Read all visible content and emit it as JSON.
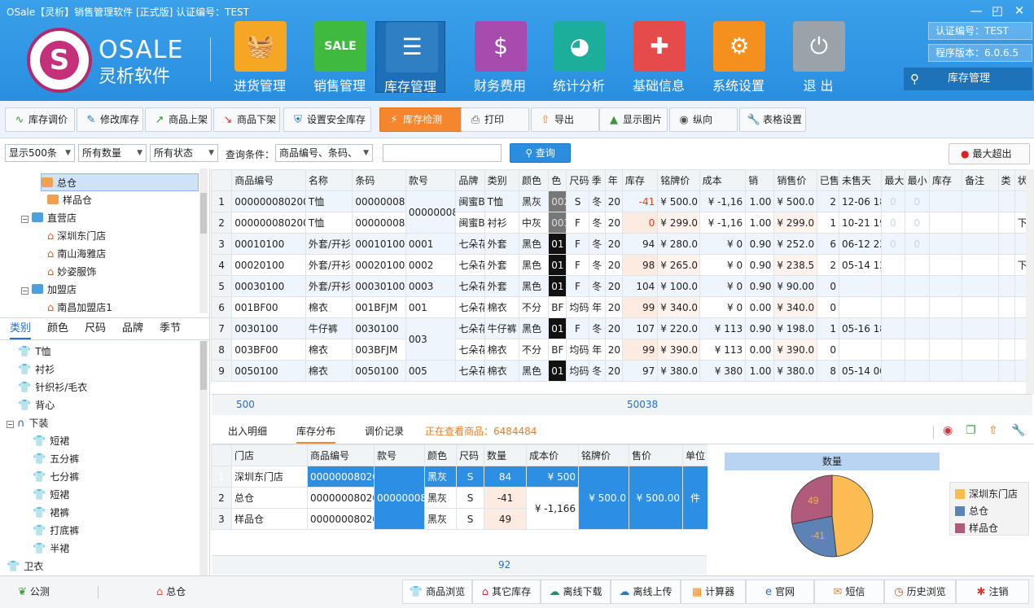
{
  "window": {
    "title": "OSale【灵析】销售管理软件   [正式版]  认证编号：TEST"
  },
  "brand": {
    "name": "OSALE",
    "subtitle": "灵析软件"
  },
  "modules": [
    {
      "label": "进货管理",
      "color": "#f5a623",
      "icon": "basket-icon",
      "glyph": "🧺"
    },
    {
      "label": "销售管理",
      "color": "#3fba3f",
      "icon": "sale-sign-icon",
      "glyph": "SALE"
    },
    {
      "label": "库存管理",
      "color": "#2f7fc4",
      "icon": "inventory-box-icon",
      "glyph": "☰"
    },
    {
      "label": "财务费用",
      "color": "#a74cae",
      "icon": "money-bag-icon",
      "glyph": "$"
    },
    {
      "label": "统计分析",
      "color": "#1cae9a",
      "icon": "pie-chart-icon",
      "glyph": "◕"
    },
    {
      "label": "基础信息",
      "color": "#e54b4b",
      "icon": "puzzle-icon",
      "glyph": "✚"
    },
    {
      "label": "系统设置",
      "color": "#f5901e",
      "icon": "gear-icon",
      "glyph": "⚙"
    },
    {
      "label": "退 出",
      "color": "#9aa3aa",
      "icon": "power-icon",
      "glyph": "⏻"
    }
  ],
  "info": {
    "cert": "认证编号：TEST",
    "version": "程序版本：6.0.6.5",
    "nav_search": "库存管理"
  },
  "toolbar": [
    {
      "label": "库存调价",
      "icon": "adjust-price-icon",
      "glyph": "∿"
    },
    {
      "label": "修改库存",
      "icon": "edit-icon",
      "glyph": "✎"
    },
    {
      "label": "商品上架",
      "icon": "trend-up-icon",
      "glyph": "↗"
    },
    {
      "label": "商品下架",
      "icon": "trend-down-icon",
      "glyph": "↘"
    },
    {
      "label": "设置安全库存",
      "icon": "shield-icon",
      "glyph": "⛨"
    },
    {
      "label": "库存检测",
      "icon": "lightning-icon",
      "glyph": "⚡"
    },
    {
      "label": "打印",
      "icon": "printer-icon",
      "glyph": "⎙"
    },
    {
      "label": "导出",
      "icon": "export-icon",
      "glyph": "⇧"
    },
    {
      "label": "显示图片",
      "icon": "image-icon",
      "glyph": "▲"
    },
    {
      "label": "纵向",
      "icon": "orientation-icon",
      "glyph": "◉"
    },
    {
      "label": "表格设置",
      "icon": "wrench-icon",
      "glyph": "🔧"
    }
  ],
  "filters": {
    "show": "显示500条",
    "qty": "所有数量",
    "status": "所有状态",
    "cond_label": "查询条件：",
    "cond": "商品编号、条码、",
    "search_value": "",
    "query": "查询",
    "max": "最大超出"
  },
  "tree": {
    "items": [
      "总仓",
      "样品仓",
      "直营店",
      "深圳东门店",
      "南山海雅店",
      "妙姿服饰",
      "加盟店",
      "南昌加盟店1"
    ]
  },
  "cat_tabs": [
    "类别",
    "颜色",
    "尺码",
    "品牌",
    "季节"
  ],
  "categories": [
    "T恤",
    "衬衫",
    "针织衫/毛衣",
    "背心",
    "下装",
    "短裙",
    "五分裤",
    "七分裤",
    "短裙",
    "裙裤",
    "打底裤",
    "半裙",
    "卫衣"
  ],
  "grid": {
    "headers": [
      "商品编号",
      "名称",
      "条码",
      "款号",
      "品牌",
      "类别",
      "颜色",
      "色",
      "尺码",
      "季",
      "年",
      "库存",
      "铭牌价",
      "成本",
      "销",
      "销售价",
      "已售",
      "未售天",
      "最大",
      "最小",
      "库存",
      "备注",
      "类",
      "状"
    ],
    "rows": [
      {
        "n": "1",
        "code": "000000080200",
        "name": "T恤",
        "bar": "000000080",
        "style": "00000008",
        "brand": "闽蜜B",
        "cat": "T恤",
        "color": "黑灰",
        "cc": "002",
        "size": "S",
        "season": "冬",
        "year": "20",
        "stock": "-41",
        "tag": "¥ 500.0",
        "cost": "¥ -1,16",
        "disc": "1.00",
        "price": "¥ 500.0",
        "sold": "2",
        "days": "12-06 18",
        "mx": "0",
        "mn": "0",
        "st": ""
      },
      {
        "n": "2",
        "code": "000000080200",
        "name": "T恤",
        "bar": "000000080",
        "style": "",
        "brand": "闽蜜B",
        "cat": "衬衫",
        "color": "中灰",
        "cc": "003",
        "size": "F",
        "season": "冬",
        "year": "20",
        "stock": "0",
        "tag": "¥ 299.0",
        "cost": "¥ -1,16",
        "disc": "1.00",
        "price": "¥ 299.0",
        "sold": "1",
        "days": "10-21 19",
        "mx": "0",
        "mn": "0",
        "st": "下"
      },
      {
        "n": "3",
        "code": "00010100",
        "name": "外套/开衫",
        "bar": "00010100",
        "style": "0001",
        "brand": "七朵花",
        "cat": "外套",
        "color": "黑色",
        "cc": "01",
        "size": "F",
        "season": "冬",
        "year": "20",
        "stock": "94",
        "tag": "¥ 280.0",
        "cost": "¥ 0",
        "disc": "0.90",
        "price": "¥ 252.0",
        "sold": "6",
        "days": "06-12 22",
        "mx": "0",
        "mn": "0",
        "st": ""
      },
      {
        "n": "4",
        "code": "00020100",
        "name": "外套/开衫",
        "bar": "00020100",
        "style": "0002",
        "brand": "七朵花",
        "cat": "外套",
        "color": "黑色",
        "cc": "01",
        "size": "F",
        "season": "冬",
        "year": "20",
        "stock": "98",
        "tag": "¥ 265.0",
        "cost": "¥ 0",
        "disc": "0.90",
        "price": "¥ 238.5",
        "sold": "2",
        "days": "05-14 12",
        "mx": "",
        "mn": "",
        "st": "下"
      },
      {
        "n": "5",
        "code": "00030100",
        "name": "外套/开衫",
        "bar": "00030100",
        "style": "0003",
        "brand": "七朵花",
        "cat": "外套",
        "color": "黑色",
        "cc": "01",
        "size": "F",
        "season": "冬",
        "year": "20",
        "stock": "104",
        "tag": "¥ 100.0",
        "cost": "¥ 0",
        "disc": "0.90",
        "price": "¥ 90.00",
        "sold": "0",
        "days": "",
        "mx": "",
        "mn": "",
        "st": ""
      },
      {
        "n": "6",
        "code": "001BF00",
        "name": "棉衣",
        "bar": "001BFJM",
        "style": "001",
        "brand": "七朵花",
        "cat": "棉衣",
        "color": "不分",
        "cc": "BF",
        "size": "均码",
        "season": "年",
        "year": "20",
        "stock": "99",
        "tag": "¥ 340.0",
        "cost": "¥ 0",
        "disc": "0.00",
        "price": "¥ 340.0",
        "sold": "0",
        "days": "",
        "mx": "",
        "mn": "",
        "st": ""
      },
      {
        "n": "7",
        "code": "0030100",
        "name": "牛仔裤",
        "bar": "0030100",
        "style": "003",
        "brand": "七朵花",
        "cat": "牛仔裤",
        "color": "黑色",
        "cc": "01",
        "size": "F",
        "season": "冬",
        "year": "20",
        "stock": "107",
        "tag": "¥ 220.0",
        "cost": "¥ 113",
        "disc": "0.90",
        "price": "¥ 198.0",
        "sold": "1",
        "days": "05-16 18",
        "mx": "",
        "mn": "",
        "st": ""
      },
      {
        "n": "8",
        "code": "003BF00",
        "name": "棉衣",
        "bar": "003BFJM",
        "style": "",
        "brand": "七朵花",
        "cat": "棉衣",
        "color": "不分",
        "cc": "BF",
        "size": "均码",
        "season": "年",
        "year": "20",
        "stock": "99",
        "tag": "¥ 390.0",
        "cost": "¥ 113",
        "disc": "0.00",
        "price": "¥ 390.0",
        "sold": "0",
        "days": "",
        "mx": "",
        "mn": "",
        "st": ""
      },
      {
        "n": "9",
        "code": "0050100",
        "name": "棉衣",
        "bar": "0050100",
        "style": "005",
        "brand": "七朵花",
        "cat": "棉衣",
        "color": "黑色",
        "cc": "01",
        "size": "均码",
        "season": "冬",
        "year": "20",
        "stock": "97",
        "tag": "¥ 380.0",
        "cost": "¥ 380",
        "disc": "1.00",
        "price": "¥ 380.0",
        "sold": "8",
        "days": "05-14 00",
        "mx": "",
        "mn": "",
        "st": ""
      }
    ],
    "footer_count": "500",
    "footer_stock": "50038"
  },
  "bottom": {
    "tabs": [
      "出入明细",
      "库存分布",
      "调价记录"
    ],
    "viewing": "正在查看商品：6484484",
    "headers": [
      "门店",
      "商品编号",
      "款号",
      "颜色",
      "尺码",
      "数量",
      "成本价",
      "铭牌价",
      "售价",
      "单位"
    ],
    "rows": [
      {
        "n": "1",
        "store": "深圳东门店",
        "code": "000000080200",
        "color": "黑灰",
        "size": "S",
        "qty": "84",
        "cost": "¥ 500"
      },
      {
        "n": "2",
        "store": "总仓",
        "code": "000000080200",
        "color": "黑灰",
        "size": "S",
        "qty": "-41",
        "cost": "¥ -1,166"
      },
      {
        "n": "3",
        "store": "样品仓",
        "code": "000000080200",
        "color": "黑灰",
        "size": "S",
        "qty": "49",
        "cost": ""
      }
    ],
    "style": "00000008",
    "tag": "¥ 500.0",
    "price": "¥ 500.00",
    "unit": "件",
    "total": "92"
  },
  "chart_data": {
    "type": "pie",
    "title": "数量",
    "categories": [
      "深圳东门店",
      "总仓",
      "样品仓"
    ],
    "values": [
      84,
      -41,
      49
    ],
    "colors": [
      "#fbbd53",
      "#5c82b6",
      "#b05a7c"
    ],
    "legend": "right"
  },
  "status": {
    "left": [
      {
        "label": "公测",
        "icon": "leaf-icon"
      },
      {
        "label": "总仓",
        "icon": "home-icon"
      }
    ],
    "buttons": [
      {
        "label": "商品浏览",
        "icon": "browse-icon",
        "glyph": "👕"
      },
      {
        "label": "其它库存",
        "icon": "home-icon",
        "glyph": "⌂"
      },
      {
        "label": "离线下载",
        "icon": "cloud-download-icon",
        "glyph": "☁"
      },
      {
        "label": "离线上传",
        "icon": "cloud-upload-icon",
        "glyph": "☁"
      },
      {
        "label": "计算器",
        "icon": "calculator-icon",
        "glyph": "▦"
      },
      {
        "label": "官网",
        "icon": "ie-icon",
        "glyph": "e"
      },
      {
        "label": "短信",
        "icon": "sms-icon",
        "glyph": "✉"
      },
      {
        "label": "历史浏览",
        "icon": "history-icon",
        "glyph": "◷"
      },
      {
        "label": "注销",
        "icon": "logout-icon",
        "glyph": "✱"
      }
    ]
  }
}
